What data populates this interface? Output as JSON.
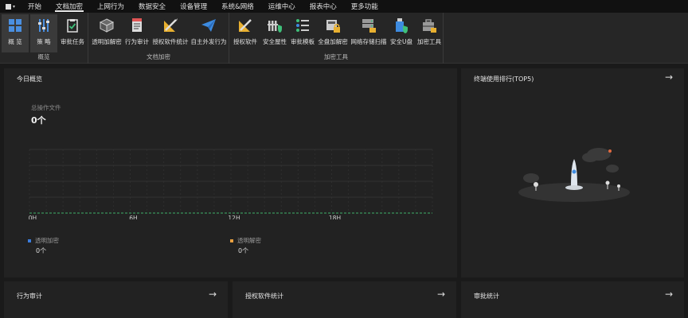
{
  "menu": {
    "tabs": [
      "开始",
      "文档加密",
      "上网行为",
      "数据安全",
      "设备管理",
      "系统&网络",
      "运维中心",
      "报表中心",
      "更多功能"
    ],
    "active": "文档加密"
  },
  "ribbon": {
    "groups": [
      {
        "label": "概览",
        "buttons": [
          {
            "label": "概 览",
            "icon": "grid-icon"
          },
          {
            "label": "策 略",
            "icon": "sliders-icon"
          },
          {
            "label": "审批任务",
            "icon": "clipboard-check-icon"
          }
        ]
      },
      {
        "label": "文档加密",
        "buttons": [
          {
            "label": "透明加解密",
            "icon": "cube-icon"
          },
          {
            "label": "行为审计",
            "icon": "audit-document-icon"
          },
          {
            "label": "授权软件统计",
            "icon": "ruler-pencil-icon"
          },
          {
            "label": "自主外发行为",
            "icon": "paper-plane-icon"
          }
        ]
      },
      {
        "label": "加密工具",
        "buttons": [
          {
            "label": "授权软件",
            "icon": "ruler-pencil-icon"
          },
          {
            "label": "安全屋性",
            "icon": "fence-shield-icon"
          },
          {
            "label": "审批模板",
            "icon": "list-check-icon"
          },
          {
            "label": "全盘加解密",
            "icon": "disk-lock-icon"
          },
          {
            "label": "网络存储扫描",
            "icon": "server-scan-icon"
          },
          {
            "label": "安全U盘",
            "icon": "usb-shield-icon"
          },
          {
            "label": "加密工具",
            "icon": "toolbox-lock-icon"
          }
        ]
      }
    ]
  },
  "today": {
    "title": "今日概览",
    "stat_label": "总操作文件",
    "stat_value": "0个",
    "legend": [
      {
        "label": "透明加密",
        "value": "0个",
        "color": "#3b7ddd"
      },
      {
        "label": "透明解密",
        "value": "0个",
        "color": "#e8a040"
      }
    ]
  },
  "chart_data": {
    "type": "line",
    "x": [
      "0H",
      "6H",
      "12H",
      "18H"
    ],
    "series": [
      {
        "name": "透明加密",
        "values": [
          0,
          0,
          0,
          0
        ]
      },
      {
        "name": "透明解密",
        "values": [
          0,
          0,
          0,
          0
        ]
      }
    ],
    "grid": true
  },
  "top5": {
    "title": "终端使用排行(TOP5)"
  },
  "bottom_cards": [
    {
      "title": "行为审计"
    },
    {
      "title": "授权软件统计"
    },
    {
      "title": "审批统计"
    }
  ],
  "icons": {
    "arrow": "→"
  }
}
